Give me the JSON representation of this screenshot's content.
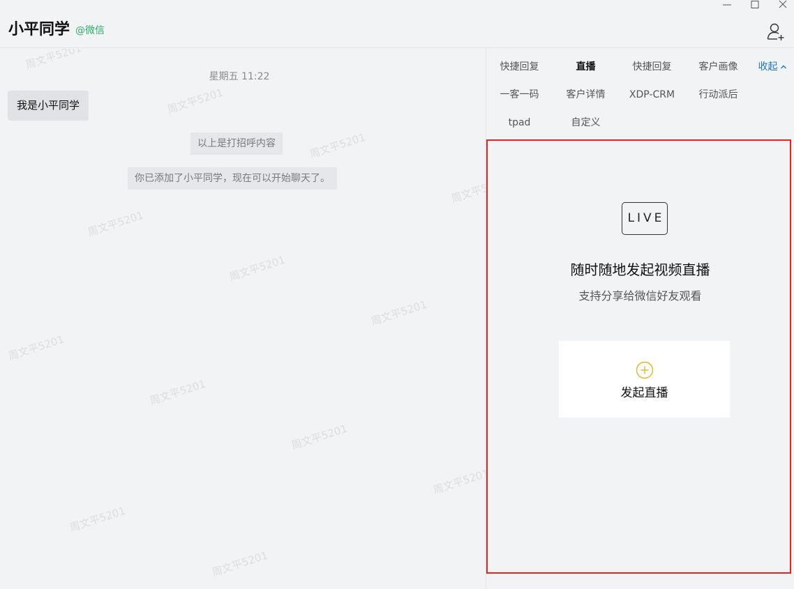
{
  "window": {
    "minimize_icon": "minimize-icon",
    "maximize_icon": "maximize-icon",
    "close_icon": "close-icon"
  },
  "header": {
    "contact_name": "小平同学",
    "contact_source": "@微信",
    "add_user_icon": "add-user-icon"
  },
  "chat": {
    "timestamp": "星期五 11:22",
    "messages": [
      {
        "text": "我是小平同学"
      }
    ],
    "system_messages": [
      "以上是打招呼内容",
      "你已添加了小平同学，现在可以开始聊天了。"
    ],
    "watermark_text": "周文平5201"
  },
  "side_panel": {
    "tabs": [
      {
        "label": "快捷回复",
        "active": false
      },
      {
        "label": "直播",
        "active": true
      },
      {
        "label": "快捷回复",
        "active": false
      },
      {
        "label": "客户画像",
        "active": false
      },
      {
        "label": "收起",
        "active": false
      },
      {
        "label": "一客一码",
        "active": false
      },
      {
        "label": "客户详情",
        "active": false
      },
      {
        "label": "XDP-CRM",
        "active": false
      },
      {
        "label": "行动派后",
        "active": false
      },
      {
        "label": "tpad",
        "active": false
      },
      {
        "label": "自定义",
        "active": false
      }
    ],
    "live": {
      "icon_label": "LIVE",
      "title": "随时随地发起视频直播",
      "subtitle": "支持分享给微信好友观看",
      "start_button_label": "发起直播",
      "start_icon": "plus-circle-icon"
    }
  },
  "colors": {
    "background": "#f2f3f5",
    "source_green": "#2aae67",
    "link_blue": "#1677d8",
    "highlight_red": "#e5241d",
    "plus_yellow": "#e6b422"
  }
}
